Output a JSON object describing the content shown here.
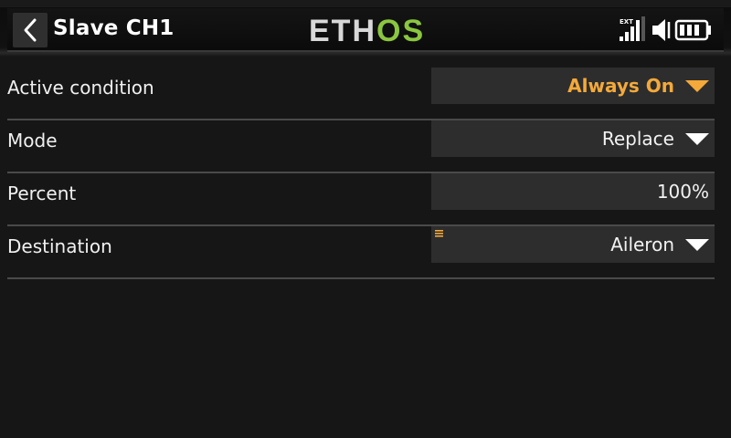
{
  "header": {
    "title": "Slave CH1",
    "logo_part1": "ETH",
    "logo_part2": "OS",
    "ext_label": "EXT"
  },
  "colors": {
    "accent": "#f4a93a",
    "logo_green": "#8bc63f",
    "field_bg": "#2d2d2d",
    "background": "#161616"
  },
  "rows": [
    {
      "label": "Active condition",
      "value": "Always On",
      "has_dropdown": true,
      "accent": true
    },
    {
      "label": "Mode",
      "value": "Replace",
      "has_dropdown": true
    },
    {
      "label": "Percent",
      "value": "100%",
      "has_dropdown": false
    },
    {
      "label": "Destination",
      "value": "Aileron",
      "has_dropdown": true,
      "has_marker": true
    }
  ],
  "icons": [
    "back-chevron-icon",
    "signal-bars-icon",
    "speaker-icon",
    "battery-icon",
    "dropdown-arrow-icon",
    "list-marker-icon"
  ]
}
